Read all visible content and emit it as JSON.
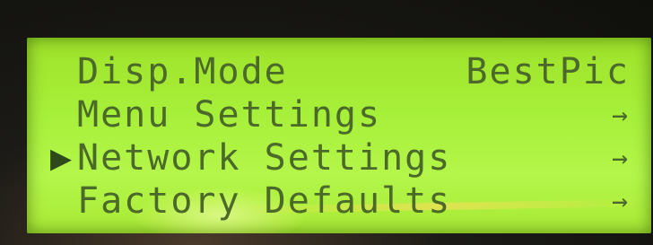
{
  "menu": {
    "rows": [
      {
        "cursor": "",
        "label": "Disp.Mode",
        "value": "BestPic",
        "arrow": ""
      },
      {
        "cursor": "",
        "label": "Menu Settings",
        "value": "",
        "arrow": "→"
      },
      {
        "cursor": "▶",
        "label": "Network Settings",
        "value": "",
        "arrow": "→"
      },
      {
        "cursor": "",
        "label": "Factory Defaults",
        "value": "",
        "arrow": "→"
      }
    ],
    "selected_index": 2
  },
  "colors": {
    "lcd_background": "#a7f03a",
    "lcd_text": "#4b6a2a",
    "bezel": "#1b1a16"
  },
  "icons": {
    "selection_cursor": "triangle-right-icon",
    "submenu_arrow": "arrow-right-icon"
  }
}
